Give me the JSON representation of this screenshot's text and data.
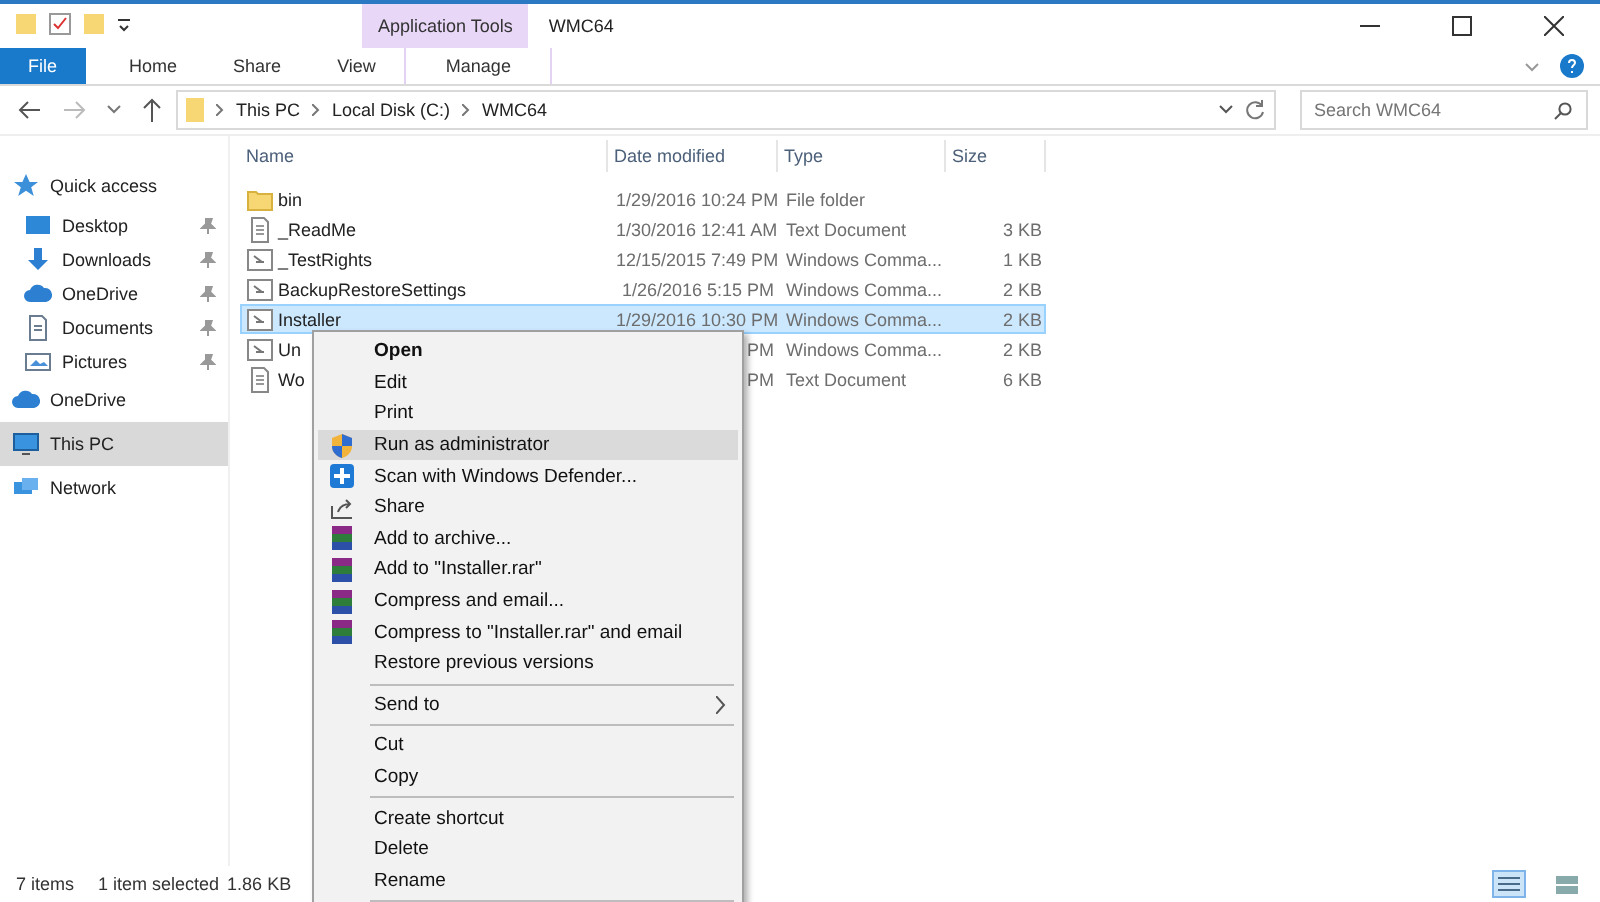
{
  "window": {
    "title": "WMC64",
    "context_tab": "Application Tools"
  },
  "ribbon_tabs": [
    {
      "label": "File",
      "kind": "file"
    },
    {
      "label": "Home",
      "kind": "tab"
    },
    {
      "label": "Share",
      "kind": "tab"
    },
    {
      "label": "View",
      "kind": "tab"
    },
    {
      "label": "Manage",
      "kind": "context"
    }
  ],
  "address": {
    "breadcrumbs": [
      "This PC",
      "Local Disk (C:)",
      "WMC64"
    ],
    "search_placeholder": "Search WMC64"
  },
  "navigation": [
    {
      "label": "Quick access",
      "kind": "star",
      "selected": false,
      "children": [
        {
          "label": "Desktop",
          "kind": "desktop",
          "pinned": true,
          "selected": false
        },
        {
          "label": "Downloads",
          "kind": "download",
          "pinned": true,
          "selected": false
        },
        {
          "label": "OneDrive",
          "kind": "cloud",
          "pinned": true,
          "selected": false
        },
        {
          "label": "Documents",
          "kind": "document",
          "pinned": true,
          "selected": false
        },
        {
          "label": "Pictures",
          "kind": "pictures",
          "pinned": true,
          "selected": false
        }
      ]
    },
    {
      "label": "OneDrive",
      "kind": "cloud",
      "selected": false
    },
    {
      "label": "This PC",
      "kind": "pc",
      "selected": true
    },
    {
      "label": "Network",
      "kind": "network",
      "selected": false
    }
  ],
  "columns": [
    "Name",
    "Date modified",
    "Type",
    "Size"
  ],
  "rows": [
    {
      "kind": "folder",
      "name": "bin",
      "date": "1/29/2016 10:24 PM",
      "type": "File folder",
      "size": "",
      "selected": false
    },
    {
      "kind": "text",
      "name": "_ReadMe",
      "date": "1/30/2016 12:41 AM",
      "type": "Text Document",
      "size": "3 KB",
      "selected": false
    },
    {
      "kind": "script",
      "name": "_TestRights",
      "date": "12/15/2015 7:49 PM",
      "type": "Windows Comma...",
      "size": "1 KB",
      "selected": false
    },
    {
      "kind": "script",
      "name": "BackupRestoreSettings",
      "date": "1/26/2016 5:15 PM",
      "type": "Windows Comma...",
      "size": "2 KB",
      "selected": false
    },
    {
      "kind": "script",
      "name": "Installer",
      "date": "1/29/2016 10:30 PM",
      "type": "Windows Comma...",
      "size": "2 KB",
      "selected": true
    },
    {
      "kind": "script",
      "name": "Un",
      "date": "PM",
      "type": "Windows Comma...",
      "size": "2 KB",
      "selected": false
    },
    {
      "kind": "text",
      "name": "Wo",
      "date": "PM",
      "type": "Text Document",
      "size": "6 KB",
      "selected": false
    }
  ],
  "context_menu": [
    {
      "kind": "item",
      "label": "Open",
      "default": true,
      "selected": false
    },
    {
      "kind": "item",
      "label": "Edit",
      "default": false,
      "selected": false
    },
    {
      "kind": "item",
      "label": "Print",
      "default": false,
      "selected": false
    },
    {
      "kind": "shield",
      "label": "Run as administrator",
      "default": false,
      "selected": true
    },
    {
      "kind": "defender",
      "label": "Scan with Windows Defender...",
      "default": false,
      "selected": false
    },
    {
      "kind": "share",
      "label": "Share",
      "default": false,
      "selected": false
    },
    {
      "kind": "archive",
      "label": "Add to archive...",
      "default": false,
      "selected": false
    },
    {
      "kind": "archive",
      "label": "Add to \"Installer.rar\"",
      "default": false,
      "selected": false
    },
    {
      "kind": "archive",
      "label": "Compress and email...",
      "default": false,
      "selected": false
    },
    {
      "kind": "archive",
      "label": "Compress to \"Installer.rar\" and email",
      "default": false,
      "selected": false
    },
    {
      "kind": "item",
      "label": "Restore previous versions",
      "default": false,
      "selected": false
    },
    {
      "kind": "separator"
    },
    {
      "kind": "submenu",
      "label": "Send to",
      "default": false,
      "selected": false
    },
    {
      "kind": "separator"
    },
    {
      "kind": "item",
      "label": "Cut",
      "default": false,
      "selected": false
    },
    {
      "kind": "item",
      "label": "Copy",
      "default": false,
      "selected": false
    },
    {
      "kind": "separator"
    },
    {
      "kind": "item",
      "label": "Create shortcut",
      "default": false,
      "selected": false
    },
    {
      "kind": "item",
      "label": "Delete",
      "default": false,
      "selected": false
    },
    {
      "kind": "item",
      "label": "Rename",
      "default": false,
      "selected": false
    },
    {
      "kind": "separator"
    }
  ],
  "status_bar": {
    "count": "7 items",
    "selection": "1 item selected",
    "size": "1.86 KB"
  },
  "view_buttons": [
    {
      "kind": "details",
      "selected": true
    },
    {
      "kind": "large",
      "selected": false
    }
  ]
}
